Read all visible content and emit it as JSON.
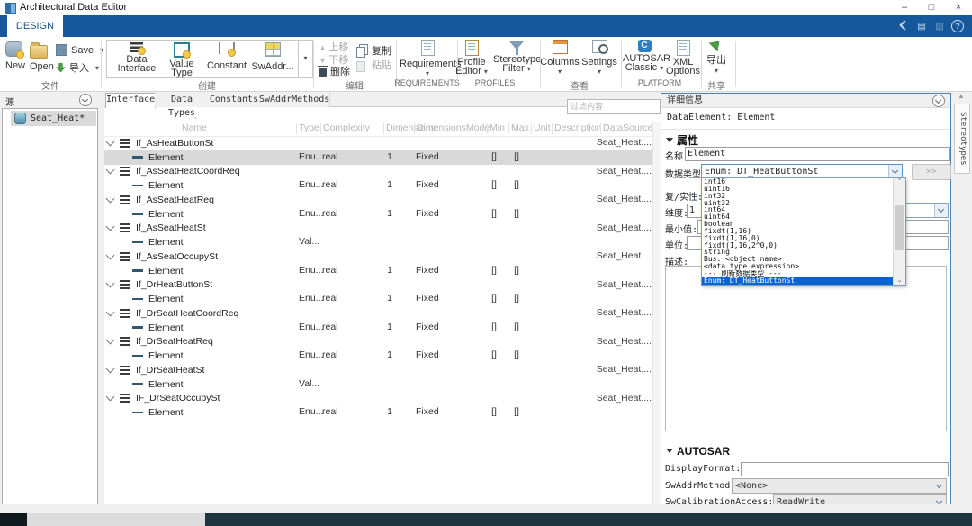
{
  "window": {
    "title": "Architectural Data Editor"
  },
  "ribbon": {
    "tab": "DESIGN",
    "file": {
      "label": "文件",
      "new": "New",
      "open": "Open",
      "save": "Save",
      "import": "导入"
    },
    "create": {
      "label": "创建",
      "data_interface_1": "Data",
      "data_interface_2": "Interface",
      "value_type_1": "Value",
      "value_type_2": "Type",
      "constant": "Constant",
      "swaddr": "SwAddr..."
    },
    "edit": {
      "label": "编辑",
      "move_up": "上移",
      "move_down": "下移",
      "delete": "删除",
      "copy": "复制",
      "paste": "粘贴"
    },
    "requirements": {
      "label": "REQUIREMENTS",
      "button": "Requirements"
    },
    "profiles": {
      "label": "PROFILES",
      "profile_editor_1": "Profile",
      "profile_editor_2": "Editor",
      "stereotype_filter_1": "Stereotype",
      "stereotype_filter_2": "Filter"
    },
    "view": {
      "label": "查看",
      "columns": "Columns",
      "settings": "Settings"
    },
    "platform": {
      "label": "PLATFORM",
      "autosar_1": "AUTOSAR",
      "autosar_2": "Classic",
      "xml_1": "XML",
      "xml_2": "Options"
    },
    "share": {
      "label": "共享",
      "export": "导出"
    }
  },
  "source_panel": {
    "header": "源",
    "item": "Seat_Heat*"
  },
  "main": {
    "tabs": [
      "Interfaces",
      "Data Types",
      "Constants",
      "SwAddrMethods"
    ],
    "filter_placeholder": "过滤内容",
    "table": {
      "columns": [
        "Name",
        "Type",
        "Complexity",
        "Dimensions",
        "DimensionsMode",
        "Min",
        "Max",
        "Unit",
        "Description",
        "DataSource"
      ],
      "rows": [
        {
          "kind": "group",
          "name": "If_AsHeatButtonSt",
          "datasource": "Seat_Heat...."
        },
        {
          "kind": "element",
          "name": "Element",
          "type": "Enu...",
          "complexity": "real",
          "dimensions": "1",
          "mode": "Fixed",
          "min": "[]",
          "max": "[]",
          "selected": true
        },
        {
          "kind": "group",
          "name": "If_AsSeatHeatCoordReq",
          "datasource": "Seat_Heat...."
        },
        {
          "kind": "element",
          "name": "Element",
          "type": "Enu...",
          "complexity": "real",
          "dimensions": "1",
          "mode": "Fixed",
          "min": "[]",
          "max": "[]"
        },
        {
          "kind": "group",
          "name": "If_AsSeatHeatReq",
          "datasource": "Seat_Heat...."
        },
        {
          "kind": "element",
          "name": "Element",
          "type": "Enu...",
          "complexity": "real",
          "dimensions": "1",
          "mode": "Fixed",
          "min": "[]",
          "max": "[]"
        },
        {
          "kind": "group",
          "name": "If_AsSeatHeatSt",
          "datasource": "Seat_Heat...."
        },
        {
          "kind": "element",
          "name": "Element",
          "type": "Val..."
        },
        {
          "kind": "group",
          "name": "If_AsSeatOccupySt",
          "datasource": "Seat_Heat...."
        },
        {
          "kind": "element",
          "name": "Element",
          "type": "Enu...",
          "complexity": "real",
          "dimensions": "1",
          "mode": "Fixed",
          "min": "[]",
          "max": "[]"
        },
        {
          "kind": "group",
          "name": "If_DrHeatButtonSt",
          "datasource": "Seat_Heat...."
        },
        {
          "kind": "element",
          "name": "Element",
          "type": "Enu...",
          "complexity": "real",
          "dimensions": "1",
          "mode": "Fixed",
          "min": "[]",
          "max": "[]"
        },
        {
          "kind": "group",
          "name": "If_DrSeatHeatCoordReq",
          "datasource": "Seat_Heat...."
        },
        {
          "kind": "element",
          "name": "Element",
          "type": "Enu...",
          "complexity": "real",
          "dimensions": "1",
          "mode": "Fixed",
          "min": "[]",
          "max": "[]"
        },
        {
          "kind": "group",
          "name": "If_DrSeatHeatReq",
          "datasource": "Seat_Heat...."
        },
        {
          "kind": "element",
          "name": "Element",
          "type": "Enu...",
          "complexity": "real",
          "dimensions": "1",
          "mode": "Fixed",
          "min": "[]",
          "max": "[]"
        },
        {
          "kind": "group",
          "name": "If_DrSeatHeatSt",
          "datasource": "Seat_Heat...."
        },
        {
          "kind": "element",
          "name": "Element",
          "type": "Val..."
        },
        {
          "kind": "group",
          "name": "IF_DrSeatOccupySt",
          "datasource": "Seat_Heat...."
        },
        {
          "kind": "element",
          "name": "Element",
          "type": "Enu...",
          "complexity": "real",
          "dimensions": "1",
          "mode": "Fixed",
          "min": "[]",
          "max": "[]"
        }
      ]
    }
  },
  "details": {
    "header": "详细信息",
    "subject": "DataElement: Element",
    "properties_section": "属性",
    "name_label": "名称:",
    "name_value": "Element",
    "datatype_label": "数据类型:",
    "datatype_value": "Enum: DT_HeatButtonSt",
    "more_button": ">>",
    "complexity_label": "复/实性:",
    "dimensions_label": "维度:",
    "dimensions_value": "1",
    "min_label": "最小值:",
    "min_value": "[]",
    "unit_label": "单位:",
    "description_label": "描述:",
    "autosar_section": "AUTOSAR",
    "display_format_label": "DisplayFormat:",
    "swaddrmethod_label": "SwAddrMethod:",
    "swaddrmethod_value": "<None>",
    "swcal_label": "SwCalibrationAccess:",
    "swcal_value": "ReadWrite",
    "datatype_dropdown": {
      "items": [
        "int16",
        "uint16",
        "int32",
        "uint32",
        "int64",
        "uint64",
        "boolean",
        "fixdt(1,16)",
        "fixdt(1,16,0)",
        "fixdt(1,16,2^0,0)",
        "string",
        "Bus: <object name>",
        "<data type expression>",
        "--- 刷新数据类型 ---",
        "Enum: DT_HeatButtonSt"
      ],
      "selected_index": 14
    }
  },
  "right_strip": {
    "tab": "Stereotypes"
  }
}
